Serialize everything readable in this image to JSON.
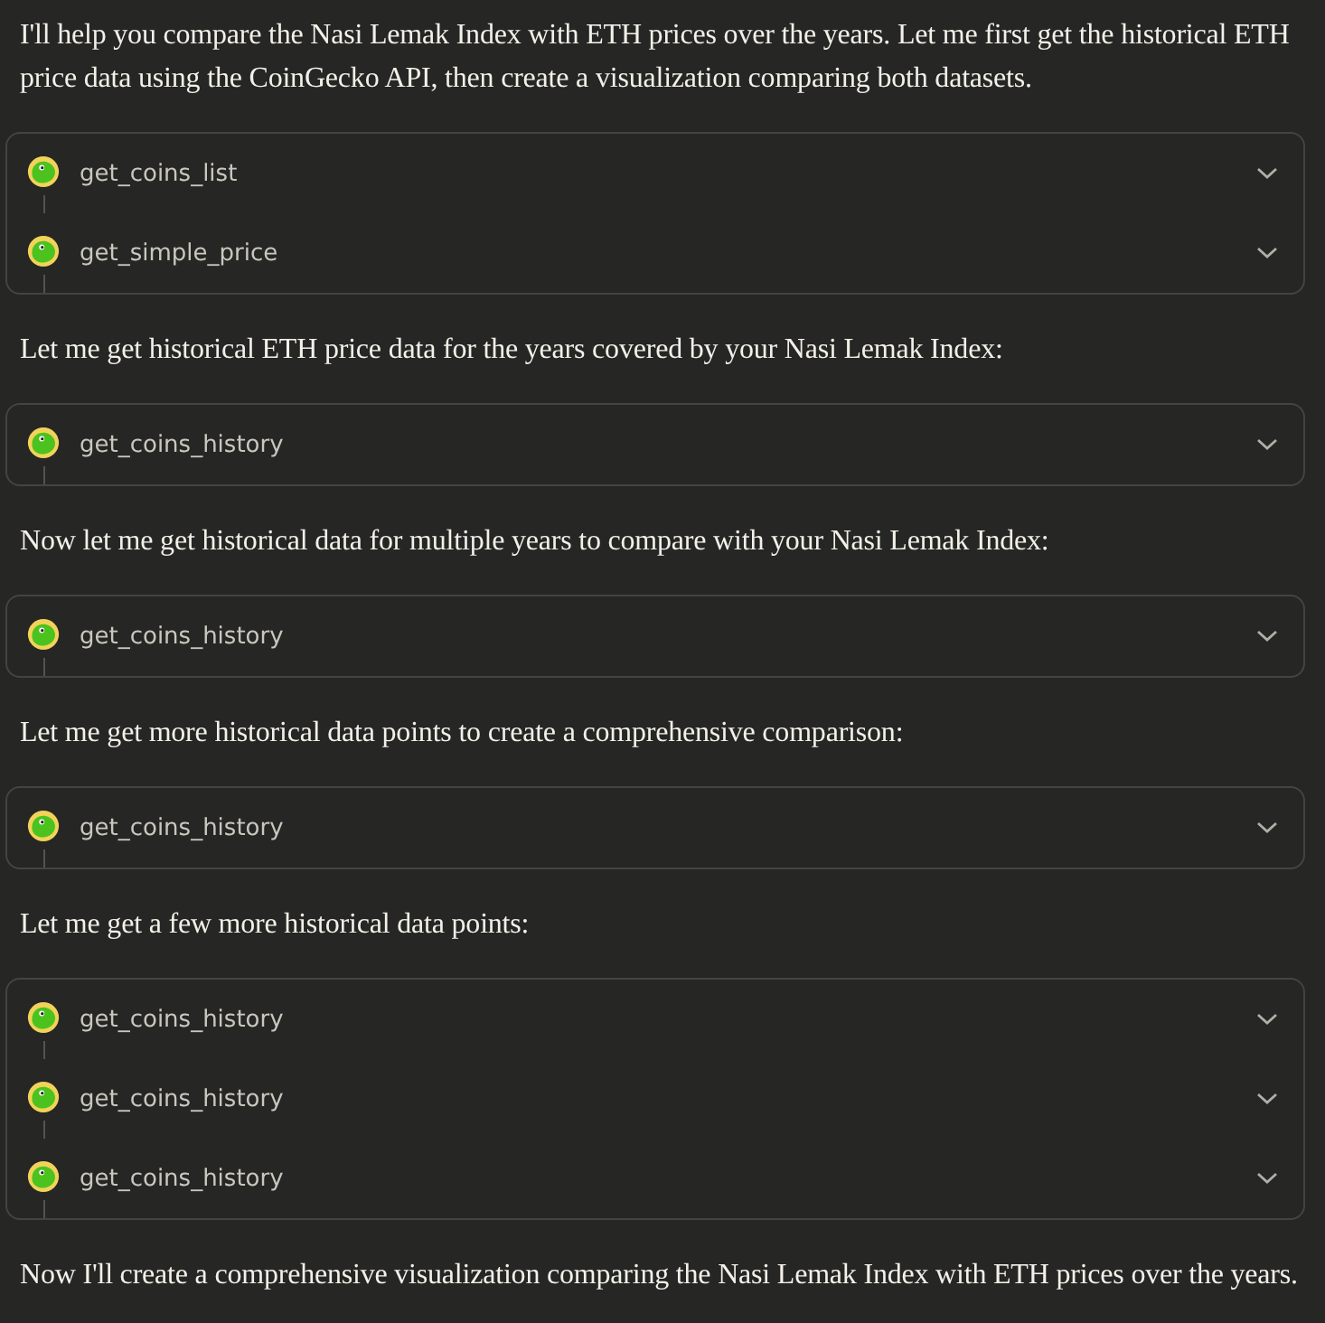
{
  "blocks": [
    {
      "kind": "text",
      "text": "I'll help you compare the Nasi Lemak Index with ETH prices over the years. Let me first get the historical ETH price data using the CoinGecko API, then create a visualization comparing both datasets."
    },
    {
      "kind": "tools",
      "items": [
        {
          "label": "get_coins_list",
          "expanded": false
        },
        {
          "label": "get_simple_price",
          "expanded": false
        }
      ]
    },
    {
      "kind": "text",
      "text": "Let me get historical ETH price data for the years covered by your Nasi Lemak Index:"
    },
    {
      "kind": "tools",
      "items": [
        {
          "label": "get_coins_history",
          "expanded": false
        }
      ]
    },
    {
      "kind": "text",
      "text": "Now let me get historical data for multiple years to compare with your Nasi Lemak Index:"
    },
    {
      "kind": "tools",
      "items": [
        {
          "label": "get_coins_history",
          "expanded": false
        }
      ]
    },
    {
      "kind": "text",
      "text": "Let me get more historical data points to create a comprehensive comparison:"
    },
    {
      "kind": "tools",
      "items": [
        {
          "label": "get_coins_history",
          "expanded": false
        }
      ]
    },
    {
      "kind": "text",
      "text": "Let me get a few more historical data points:"
    },
    {
      "kind": "tools",
      "items": [
        {
          "label": "get_coins_history",
          "expanded": false
        },
        {
          "label": "get_coins_history",
          "expanded": false
        },
        {
          "label": "get_coins_history",
          "expanded": false
        }
      ]
    },
    {
      "kind": "text",
      "text": "Now I'll create a comprehensive visualization comparing the Nasi Lemak Index with ETH prices over the years."
    }
  ]
}
